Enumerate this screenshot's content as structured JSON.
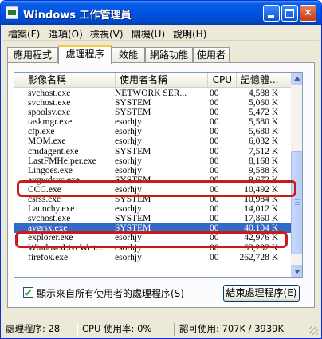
{
  "window": {
    "title": "Windows 工作管理員",
    "minimize_label": "_",
    "maximize_label": "",
    "close_label": "✕"
  },
  "menu": [
    "檔案(F)",
    "選項(O)",
    "檢視(V)",
    "關機(U)",
    "說明(H)"
  ],
  "tabs": [
    {
      "label": "應用程式",
      "active": false
    },
    {
      "label": "處理程序",
      "active": true
    },
    {
      "label": "效能",
      "active": false
    },
    {
      "label": "網路功能",
      "active": false
    },
    {
      "label": "使用者",
      "active": false
    }
  ],
  "list": {
    "columns": [
      "影像名稱",
      "使用者名稱",
      "CPU",
      "記憶體..."
    ],
    "rows": [
      {
        "name": "svchost.exe",
        "user": "NETWORK SER...",
        "cpu": "00",
        "mem": "4,588 K"
      },
      {
        "name": "svchost.exe",
        "user": "SYSTEM",
        "cpu": "00",
        "mem": "5,060 K"
      },
      {
        "name": "spoolsv.exe",
        "user": "SYSTEM",
        "cpu": "00",
        "mem": "5,472 K"
      },
      {
        "name": "taskmgr.exe",
        "user": "esorhjy",
        "cpu": "00",
        "mem": "5,580 K"
      },
      {
        "name": "cfp.exe",
        "user": "esorhjy",
        "cpu": "00",
        "mem": "5,680 K"
      },
      {
        "name": "MOM.exe",
        "user": "esorhjy",
        "cpu": "00",
        "mem": "6,032 K"
      },
      {
        "name": "cmdagent.exe",
        "user": "SYSTEM",
        "cpu": "00",
        "mem": "7,512 K"
      },
      {
        "name": "LastFMHelper.exe",
        "user": "esorhjy",
        "cpu": "00",
        "mem": "8,168 K"
      },
      {
        "name": "Lingoes.exe",
        "user": "esorhjy",
        "cpu": "00",
        "mem": "9,588 K"
      },
      {
        "name": "avgwdsvc.exe",
        "user": "SYSTEM",
        "cpu": "00",
        "mem": "9,672 K"
      },
      {
        "name": "CCC.exe",
        "user": "esorhjy",
        "cpu": "00",
        "mem": "10,492 K"
      },
      {
        "name": "csrss.exe",
        "user": "SYSTEM",
        "cpu": "00",
        "mem": "10,984 K"
      },
      {
        "name": "Launchy.exe",
        "user": "esorhjy",
        "cpu": "00",
        "mem": "14,012 K"
      },
      {
        "name": "svchost.exe",
        "user": "SYSTEM",
        "cpu": "00",
        "mem": "17,860 K"
      },
      {
        "name": "avgrsx.exe",
        "user": "SYSTEM",
        "cpu": "00",
        "mem": "40,104 K",
        "selected": true
      },
      {
        "name": "explorer.exe",
        "user": "esorhjy",
        "cpu": "00",
        "mem": "42,976 K"
      },
      {
        "name": "WindowsLiveWrit...",
        "user": "esorhjy",
        "cpu": "00",
        "mem": "63,292 K"
      },
      {
        "name": "firefox.exe",
        "user": "esorhjy",
        "cpu": "00",
        "mem": "262,728 K"
      }
    ]
  },
  "show_all_users": {
    "label": "顯示來自所有使用者的處理程序(S)",
    "checked": true
  },
  "end_process_label": "結束處理程序(E)",
  "status": {
    "processes": "處理程序: 28",
    "cpu": "CPU 使用率: 0%",
    "commit": "認可使用: 707K / 3939K"
  },
  "colors": {
    "title_blue": "#0054e3",
    "selection": "#316ac5",
    "highlight_red": "#cc1a1a"
  }
}
